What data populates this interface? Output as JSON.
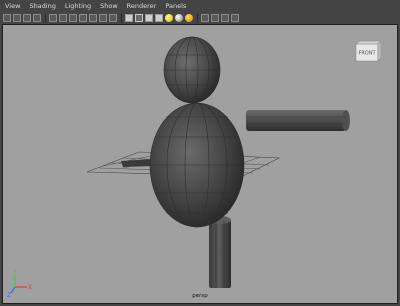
{
  "menubar": {
    "items": [
      "View",
      "Shading",
      "Lighting",
      "Show",
      "Renderer",
      "Panels"
    ]
  },
  "toolbar": {
    "icons": [
      "select-camera-icon",
      "camera-attributes-icon",
      "bookmark-icon",
      "image-plane-icon",
      "grid-icon",
      "film-gate-icon",
      "resolution-gate-icon",
      "gate-mask-icon",
      "field-chart-icon",
      "safe-action-icon",
      "safe-title-icon",
      "wireframe-icon",
      "smooth-shade-icon",
      "default-material-icon",
      "textured-icon",
      "use-all-lights-icon",
      "shadows-icon",
      "ambient-occlusion-icon",
      "anti-aliasing-icon",
      "isolate-select-icon",
      "xray-icon",
      "xray-joints-icon",
      "backface-culling-icon",
      "highlight-icon"
    ]
  },
  "viewport": {
    "camera_label": "persp",
    "viewcube_label": "FRONT",
    "background_color": "#a0a0a0",
    "axis_labels": {
      "x": "X",
      "y": "Y",
      "z": "Z"
    }
  },
  "colors": {
    "panel_bg": "#444444",
    "menu_text": "#d8d8d8",
    "axis_x": "#e03a3a",
    "axis_y": "#3ccf3c",
    "axis_z": "#3a6ae0"
  }
}
